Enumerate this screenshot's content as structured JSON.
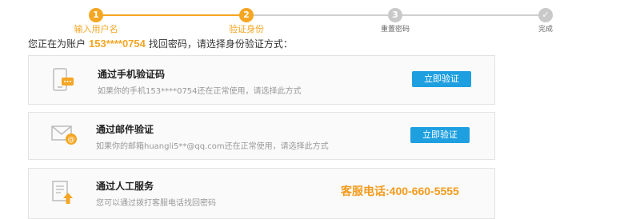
{
  "steps": [
    {
      "number": "1",
      "label": "输入用户名"
    },
    {
      "number": "2",
      "label": "验证身份"
    },
    {
      "number": "3",
      "label": "重置密码"
    },
    {
      "number": "✓",
      "label": "完成"
    }
  ],
  "intro": {
    "prefix": "您正在为账户",
    "account": "153****0754",
    "suffix": "找回密码，请选择身份验证方式："
  },
  "options": {
    "phone": {
      "title": "通过手机验证码",
      "desc": "如果你的手机153****0754还在正常使用，请选择此方式",
      "button": "立即验证"
    },
    "email": {
      "title": "通过邮件验证",
      "desc": "如果你的邮箱huangli5**@qq.com还在正常使用，请选择此方式",
      "button": "立即验证"
    },
    "service": {
      "title": "通过人工服务",
      "desc": "您可以通过拨打客服电话找回密码",
      "hotline": "客服电话:400-660-5555"
    }
  },
  "colors": {
    "accent": "#f5a623",
    "button": "#1e9fe0",
    "pending": "#c9c9c9"
  }
}
